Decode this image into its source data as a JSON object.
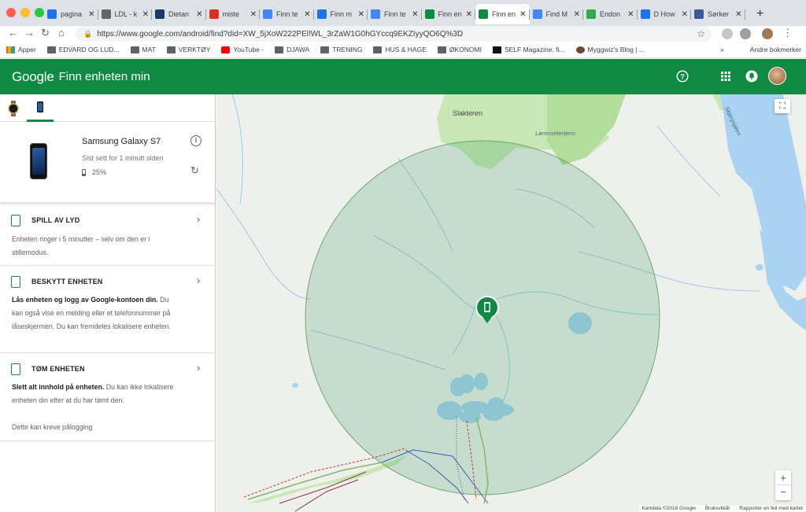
{
  "browser": {
    "tabs": [
      {
        "label": "pagina",
        "color": "#1a73e8",
        "icon": "doc"
      },
      {
        "label": "LDL - k",
        "color": "#666666",
        "icon": "doc"
      },
      {
        "label": "Dietan",
        "color": "#1a3a6b",
        "icon": "CP"
      },
      {
        "label": "miste",
        "color": "#d93025",
        "icon": "gmail"
      },
      {
        "label": "Finn te",
        "color": "#4285f4",
        "icon": "google"
      },
      {
        "label": "Finn m",
        "color": "#1a73e8",
        "icon": "S"
      },
      {
        "label": "Finn te",
        "color": "#4285f4",
        "icon": "google"
      },
      {
        "label": "Finn en",
        "color": "#0f8a43",
        "icon": "g"
      },
      {
        "label": "Finn en",
        "color": "#0f8a43",
        "icon": "g",
        "active": true
      },
      {
        "label": "Find M",
        "color": "#4285f4",
        "icon": "doc"
      },
      {
        "label": "Endon",
        "color": "#34a853",
        "icon": "doc"
      },
      {
        "label": "D How",
        "color": "#1a73e8",
        "icon": "doc"
      },
      {
        "label": "Sørker",
        "color": "#3b5998",
        "icon": "f"
      }
    ],
    "new_tab": "+",
    "url": "https://www.google.com/android/find?did=XW_5jXoW222PEl!WL_3rZaW1G0hGYccq9EKZIyyQO6Q%3D",
    "bookmarks": [
      "Apper",
      "EDVARD OG LUD...",
      "MAT",
      "VERKTØY",
      "YouTube -",
      "DJAWA",
      "TRENING",
      "HUS & HAGE",
      "ØKONOMI",
      "SELF Magazine: fi...",
      "Myggwiz's Blog | ..."
    ],
    "bookmarks_more": "»",
    "other_bookmarks": "Andre bokmerker"
  },
  "app": {
    "logo": "Google",
    "title": "Finn enheten min",
    "accent": "#0f8a43"
  },
  "device": {
    "name": "Samsung Galaxy S7",
    "last_seen": "Sist sett for 1 minutt siden",
    "battery": "25%",
    "battery_level": 0.25
  },
  "actions": [
    {
      "title": "SPILL AV LYD",
      "desc_bold": "",
      "desc": "Enheten ringer i 5 minutter – selv om den er i stillemodus."
    },
    {
      "title": "BESKYTT ENHETEN",
      "desc_bold": "Lås enheten og logg av Google-kontoen din.",
      "desc": " Du kan også vise en melding eller et telefonnummer på låseskjermen. Du kan fremdeles lokalisere enheten."
    },
    {
      "title": "TØM ENHETEN",
      "desc_bold": "Slett alt innhold på enheten.",
      "desc": " Du kan ikke lokalisere enheten din etter at du har tømt den."
    }
  ],
  "login_note": "Dette kan kreve pålogging",
  "map": {
    "labels": {
      "slakteren": "Slakteren",
      "lorensetertjern": "Lørensetertjern",
      "lake": "Skjerpsjøen"
    },
    "zoom_in": "+",
    "zoom_out": "−",
    "attribution": {
      "data": "Kartdata ©2018 Google",
      "terms": "Bruksvilkår",
      "report": "Rapporter en feil med kartet"
    }
  }
}
